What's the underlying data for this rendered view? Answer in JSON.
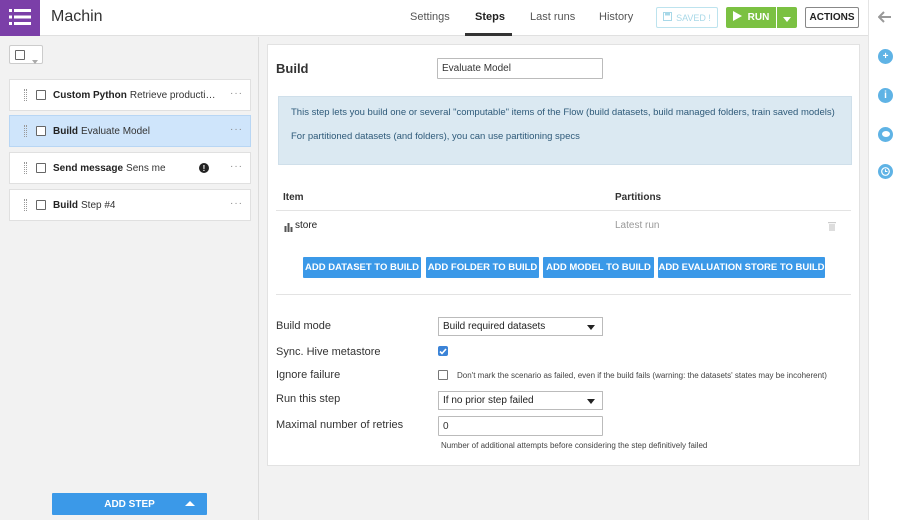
{
  "app": {
    "title": "Machin",
    "icon": "list-icon"
  },
  "nav": {
    "tabs": [
      {
        "label": "Settings",
        "active": false
      },
      {
        "label": "Steps",
        "active": true
      },
      {
        "label": "Last runs",
        "active": false
      },
      {
        "label": "History",
        "active": false
      }
    ],
    "saved_label": "SAVED !",
    "run_label": "RUN",
    "actions_label": "ACTIONS"
  },
  "rail": {
    "icons": [
      "arrow-left-icon",
      "plus-circle-icon",
      "info-icon",
      "chat-icon",
      "clock-icon"
    ]
  },
  "steps": [
    {
      "type": "Custom Python",
      "name": "Retrieve producti…",
      "selected": false,
      "warning": false
    },
    {
      "type": "Build",
      "name": "Evaluate Model",
      "selected": true,
      "warning": false
    },
    {
      "type": "Send message",
      "name": "Sens me",
      "selected": false,
      "warning": true
    },
    {
      "type": "Build",
      "name": "Step #4",
      "selected": false,
      "warning": false
    }
  ],
  "add_step_label": "ADD STEP",
  "detail": {
    "title": "Build",
    "step_name": "Evaluate Model",
    "info_line1": "This step lets you build one or several \"computable\" items of the Flow (build datasets, build managed folders, train saved models)",
    "info_line2": "For partitioned datasets (and folders), you can use partitioning specs",
    "table": {
      "col_item": "Item",
      "col_partitions": "Partitions",
      "rows": [
        {
          "item": "store",
          "partitions": "Latest run"
        }
      ]
    },
    "buttons": {
      "dataset": "ADD DATASET TO BUILD",
      "folder": "ADD FOLDER TO BUILD",
      "model": "ADD MODEL TO BUILD",
      "evalstore": "ADD EVALUATION STORE TO BUILD"
    },
    "build_mode_label": "Build mode",
    "build_mode_value": "Build required datasets",
    "sync_hive_label": "Sync. Hive metastore",
    "sync_hive_checked": true,
    "ignore_failure_label": "Ignore failure",
    "ignore_failure_checked": false,
    "ignore_failure_hint": "Don't mark the scenario as failed, even if the build fails (warning: the datasets' states may be incoherent)",
    "run_step_label": "Run this step",
    "run_step_value": "If no prior step failed",
    "retries_label": "Maximal number of retries",
    "retries_value": "0",
    "retries_hint": "Number of additional attempts before considering the step definitively failed"
  },
  "colors": {
    "brand": "#7b3fa8",
    "run": "#7bc142",
    "primary": "#3b99e8",
    "selected": "#cfe5fb"
  }
}
